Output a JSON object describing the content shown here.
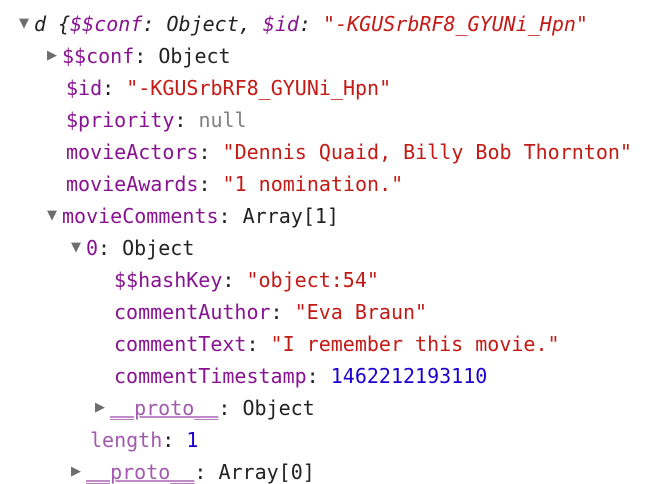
{
  "root": {
    "arrow": "▼",
    "var": "d",
    "open_brace": "{",
    "conf_key": "$$conf",
    "conf_colon": ": ",
    "conf_val": "Object",
    "sep": ", ",
    "id_key": "$id",
    "id_colon": ": ",
    "id_val": "\"-KGUSrbRF8_GYUNi_Hpn\""
  },
  "rows": {
    "conf": {
      "arrow": "▶",
      "key": "$$conf",
      "colon": ": ",
      "value": "Object"
    },
    "id": {
      "key": "$id",
      "colon": ": ",
      "value": "\"-KGUSrbRF8_GYUNi_Hpn\""
    },
    "priority": {
      "key": "$priority",
      "colon": ": ",
      "value": "null"
    },
    "movieActors": {
      "key": "movieActors",
      "colon": ": ",
      "value": "\"Dennis Quaid, Billy Bob Thornton\""
    },
    "movieAwards": {
      "key": "movieAwards",
      "colon": ": ",
      "value": "\"1 nomination.\""
    },
    "movieComments": {
      "arrow": "▼",
      "key": "movieComments",
      "colon": ": ",
      "value": "Array[1]"
    },
    "item0": {
      "arrow": "▼",
      "key": "0",
      "colon": ": ",
      "value": "Object"
    },
    "hashKey": {
      "key": "$$hashKey",
      "colon": ": ",
      "value": "\"object:54\""
    },
    "commentAuthor": {
      "key": "commentAuthor",
      "colon": ": ",
      "value": "\"Eva Braun\""
    },
    "commentText": {
      "key": "commentText",
      "colon": ": ",
      "value": "\"I remember this movie.\""
    },
    "commentTimestamp": {
      "key": "commentTimestamp",
      "colon": ": ",
      "value": "1462212193110"
    },
    "itemProto": {
      "arrow": "▶",
      "key": "__proto__",
      "colon": ": ",
      "value": "Object"
    },
    "length": {
      "key": "length",
      "colon": ": ",
      "value": "1"
    },
    "arrayProto": {
      "arrow": "▶",
      "key": "__proto__",
      "colon": ": ",
      "value": "Array[0]"
    }
  },
  "colors": {
    "key": "#881391",
    "string": "#c41a16",
    "number": "#1c00cf",
    "null": "#808080",
    "arrow": "#6e6e6e"
  }
}
